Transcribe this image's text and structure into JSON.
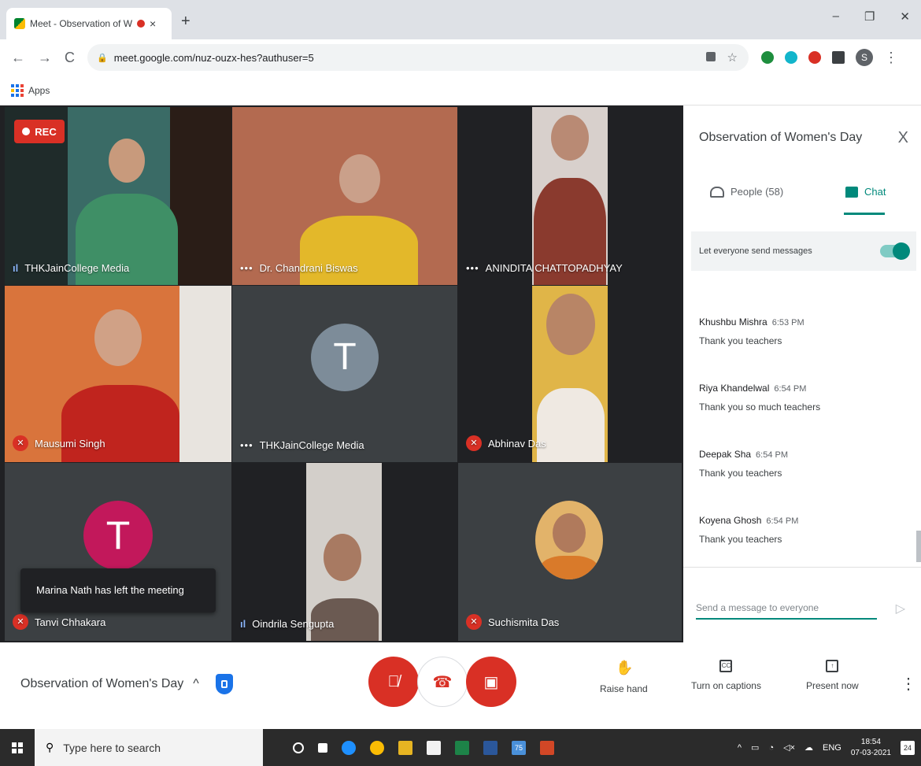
{
  "browser": {
    "tab_title": "Meet - Observation of Wom",
    "tab_close": "×",
    "new_tab": "+",
    "url": "meet.google.com/nuz-ouzx-hes?authuser=5",
    "profile_letter": "S",
    "bookmark_apps": "Apps",
    "window_controls": [
      "–",
      "❐",
      "✕"
    ]
  },
  "meet": {
    "rec_label": "REC",
    "tiles": [
      {
        "name": "THKJainCollege Media",
        "status": "speaking"
      },
      {
        "name": "Dr. Chandrani Biswas",
        "status": "dots"
      },
      {
        "name": "ANINDITA CHATTOPADHYAY",
        "status": "dots"
      },
      {
        "name": "Mausumi Singh",
        "status": "muted"
      },
      {
        "name": "THKJainCollege Media",
        "status": "dots",
        "avatar_letter": "T",
        "avatar_color": "#7d8c99"
      },
      {
        "name": "Abhinav Das",
        "status": "muted"
      },
      {
        "name": "Tanvi Chhakara",
        "status": "muted",
        "avatar_letter": "T",
        "avatar_color": "#c2185b"
      },
      {
        "name": "Oindrila Sengupta",
        "status": "speaking"
      },
      {
        "name": "Suchismita Das",
        "status": "muted"
      }
    ],
    "toast": "Marina Nath has left the meeting"
  },
  "panel": {
    "title": "Observation of Women's Day",
    "close": "X",
    "tab_people": "People (58)",
    "tab_chat": "Chat",
    "setting_label": "Let everyone send messages",
    "messages": [
      {
        "sender": "Khushbu Mishra",
        "time": "6:53 PM",
        "text": "Thank you teachers"
      },
      {
        "sender": "Riya Khandelwal",
        "time": "6:54 PM",
        "text": "Thank you so much teachers"
      },
      {
        "sender": "Deepak Sha",
        "time": "6:54 PM",
        "text": "Thank you teachers"
      },
      {
        "sender": "Koyena Ghosh",
        "time": "6:54 PM",
        "text": "Thank you teachers"
      }
    ],
    "composer_placeholder": "Send a message to everyone"
  },
  "controls": {
    "meeting_name": "Observation of Women's Day",
    "raise_hand": "Raise hand",
    "captions": "Turn on captions",
    "present": "Present now",
    "captions_icon": "CC"
  },
  "taskbar": {
    "search_placeholder": "Type here to search",
    "lang": "ENG",
    "time": "18:54",
    "date": "07-03-2021",
    "notif_count": "24",
    "badge_count": "75"
  },
  "colors": {
    "accent": "#00897b",
    "danger": "#d93025",
    "stage_bg": "#202124"
  }
}
